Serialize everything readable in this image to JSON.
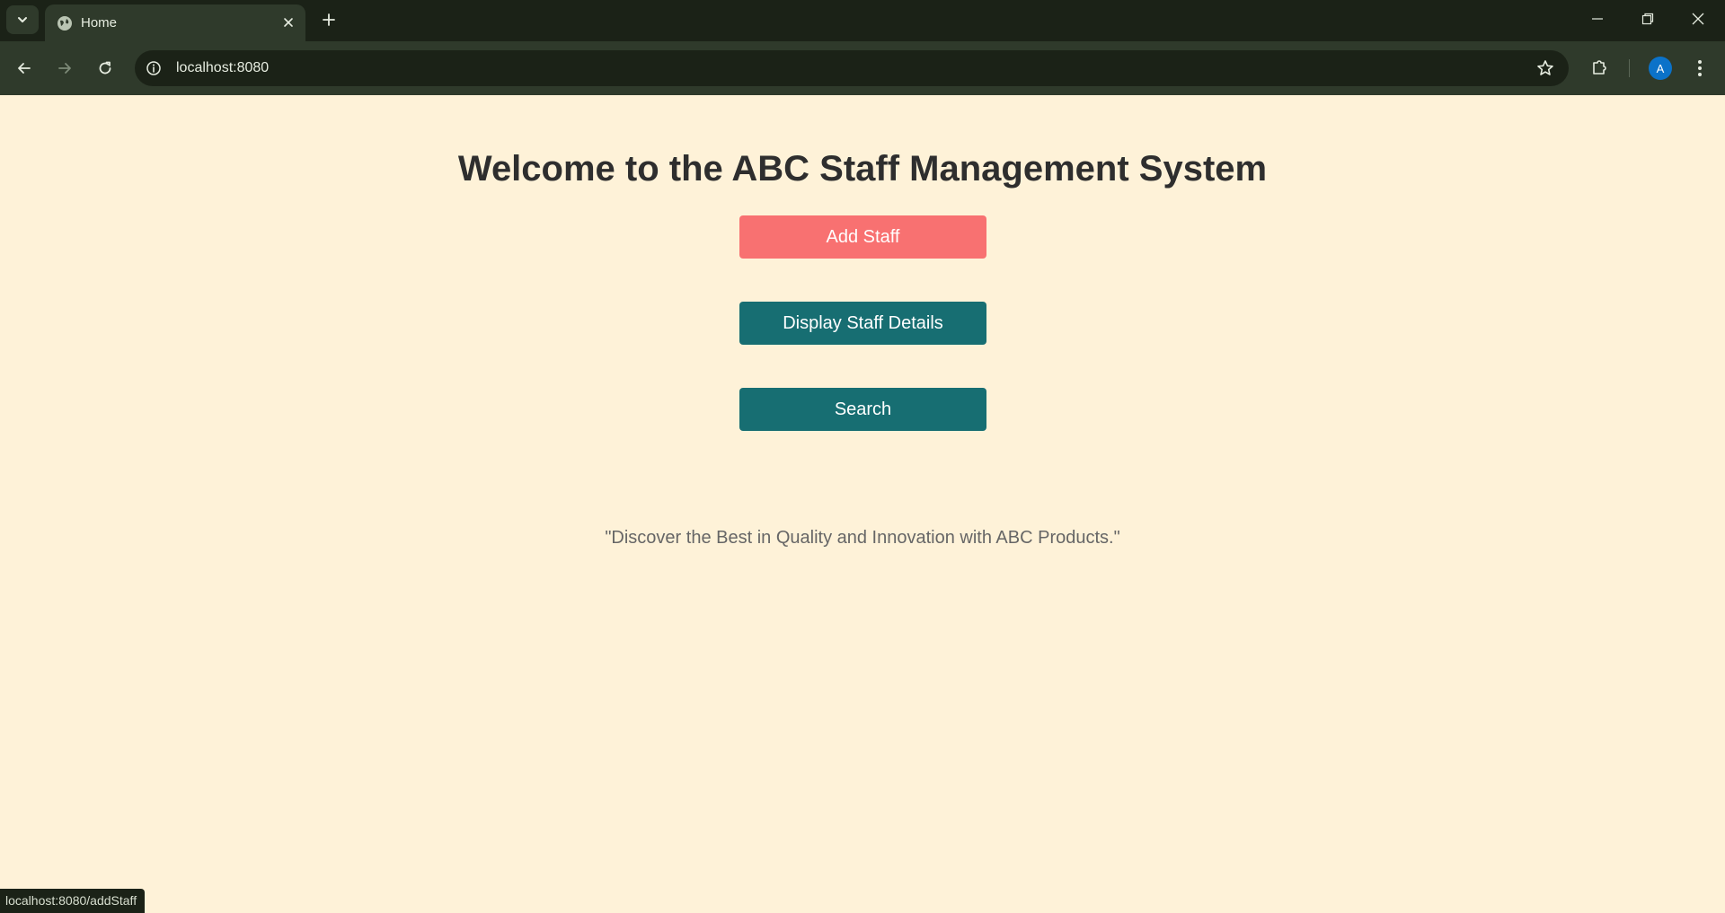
{
  "browser": {
    "tab": {
      "title": "Home"
    },
    "address_bar": {
      "url": "localhost:8080"
    },
    "profile_initial": "A",
    "status_url": "localhost:8080/addStaff"
  },
  "page": {
    "title": "Welcome to the ABC Staff Management System",
    "buttons": {
      "add_staff": "Add Staff",
      "display_staff": "Display Staff Details",
      "search": "Search"
    },
    "tagline": "\"Discover the Best in Quality and Innovation with ABC Products.\""
  },
  "colors": {
    "page_background": "#fef2d8",
    "add_button": "#f87171",
    "primary_button": "#176e72",
    "title_text": "#2e2e2e",
    "tagline_text": "#666666",
    "browser_frame": "#1b2217",
    "browser_toolbar": "#2f3a2b",
    "avatar": "#0b72c9"
  },
  "icons": {
    "tab_search": "chevron-down-icon",
    "favicon": "globe-icon",
    "tab_close": "close-icon",
    "new_tab": "plus-icon",
    "back": "arrow-left-icon",
    "forward": "arrow-right-icon",
    "reload": "reload-icon",
    "site_info": "info-icon",
    "bookmark": "star-icon",
    "extensions": "puzzle-icon",
    "menu": "kebab-menu-icon",
    "minimize": "minimize-icon",
    "restore": "restore-icon",
    "close_window": "close-icon"
  }
}
